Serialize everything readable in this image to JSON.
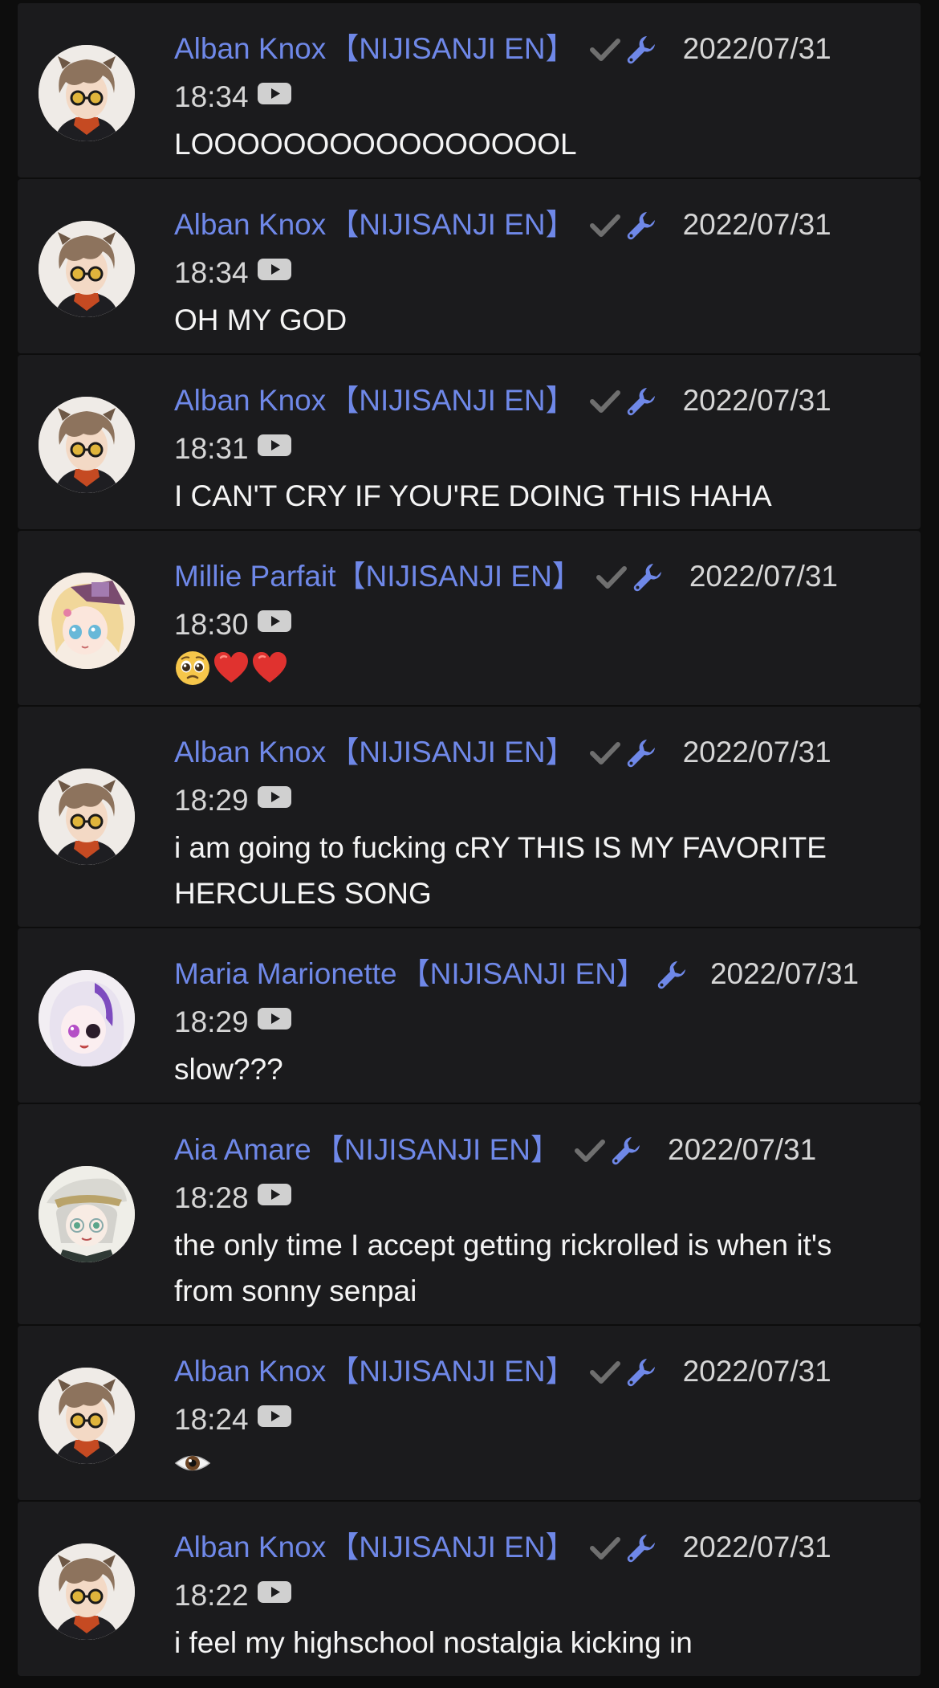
{
  "colors": {
    "background": "#0d0d0d",
    "card": "#1b1b1d",
    "name": "#6f88e8",
    "text": "#f4f4f4",
    "muted": "#d6d6d6",
    "check": "#6f6f6f",
    "wrench": "#6f88e8"
  },
  "messages": [
    {
      "author": "Alban Knox",
      "tag": "【NIJISANJI EN】",
      "verified": true,
      "moderator_icon": "wrench-icon",
      "date": "2022/07/31",
      "time": "18:34",
      "source_icon": "youtube-icon",
      "text": "LOOOOOOOOOOOOOOOOL",
      "avatar": "alban-avatar"
    },
    {
      "author": "Alban Knox",
      "tag": "【NIJISANJI EN】",
      "verified": true,
      "moderator_icon": "wrench-icon",
      "date": "2022/07/31",
      "time": "18:34",
      "source_icon": "youtube-icon",
      "text": "OH MY GOD",
      "avatar": "alban-avatar"
    },
    {
      "author": "Alban Knox",
      "tag": "【NIJISANJI EN】",
      "verified": true,
      "moderator_icon": "wrench-icon",
      "date": "2022/07/31",
      "time": "18:31",
      "source_icon": "youtube-icon",
      "text": "I CAN'T CRY IF YOU'RE DOING THIS HAHA",
      "avatar": "alban-avatar"
    },
    {
      "author": "Millie Parfait",
      "tag": "【NIJISANJI EN】",
      "verified": true,
      "moderator_icon": "wrench-icon",
      "date": "2022/07/31",
      "time": "18:30",
      "source_icon": "youtube-icon",
      "text": "",
      "emojis": [
        "pleading-face-emoji",
        "red-heart-emoji",
        "red-heart-emoji"
      ],
      "avatar": "millie-avatar"
    },
    {
      "author": "Alban Knox",
      "tag": "【NIJISANJI EN】",
      "verified": true,
      "moderator_icon": "wrench-icon",
      "date": "2022/07/31",
      "time": "18:29",
      "source_icon": "youtube-icon",
      "text": "i am going to fucking cRY THIS IS MY FAVORITE HERCULES SONG",
      "avatar": "alban-avatar"
    },
    {
      "author": "Maria Marionette",
      "tag": "【NIJISANJI EN】",
      "verified": false,
      "moderator_icon": "wrench-icon",
      "date": "2022/07/31",
      "time": "18:29",
      "source_icon": "youtube-icon",
      "text": "slow???",
      "avatar": "maria-avatar"
    },
    {
      "author": "Aia Amare",
      "tag": "【NIJISANJI EN】",
      "verified": true,
      "moderator_icon": "wrench-icon",
      "date": "2022/07/31",
      "time": "18:28",
      "source_icon": "youtube-icon",
      "text": "the only time I accept getting rickrolled is when it's from sonny senpai",
      "avatar": "aia-avatar"
    },
    {
      "author": "Alban Knox",
      "tag": "【NIJISANJI EN】",
      "verified": true,
      "moderator_icon": "wrench-icon",
      "date": "2022/07/31",
      "time": "18:24",
      "source_icon": "youtube-icon",
      "text": "",
      "emojis": [
        "eye-emoji"
      ],
      "avatar": "alban-avatar"
    },
    {
      "author": "Alban Knox",
      "tag": "【NIJISANJI EN】",
      "verified": true,
      "moderator_icon": "wrench-icon",
      "date": "2022/07/31",
      "time": "18:22",
      "source_icon": "youtube-icon",
      "text": "i feel my highschool nostalgia kicking in",
      "avatar": "alban-avatar"
    }
  ]
}
